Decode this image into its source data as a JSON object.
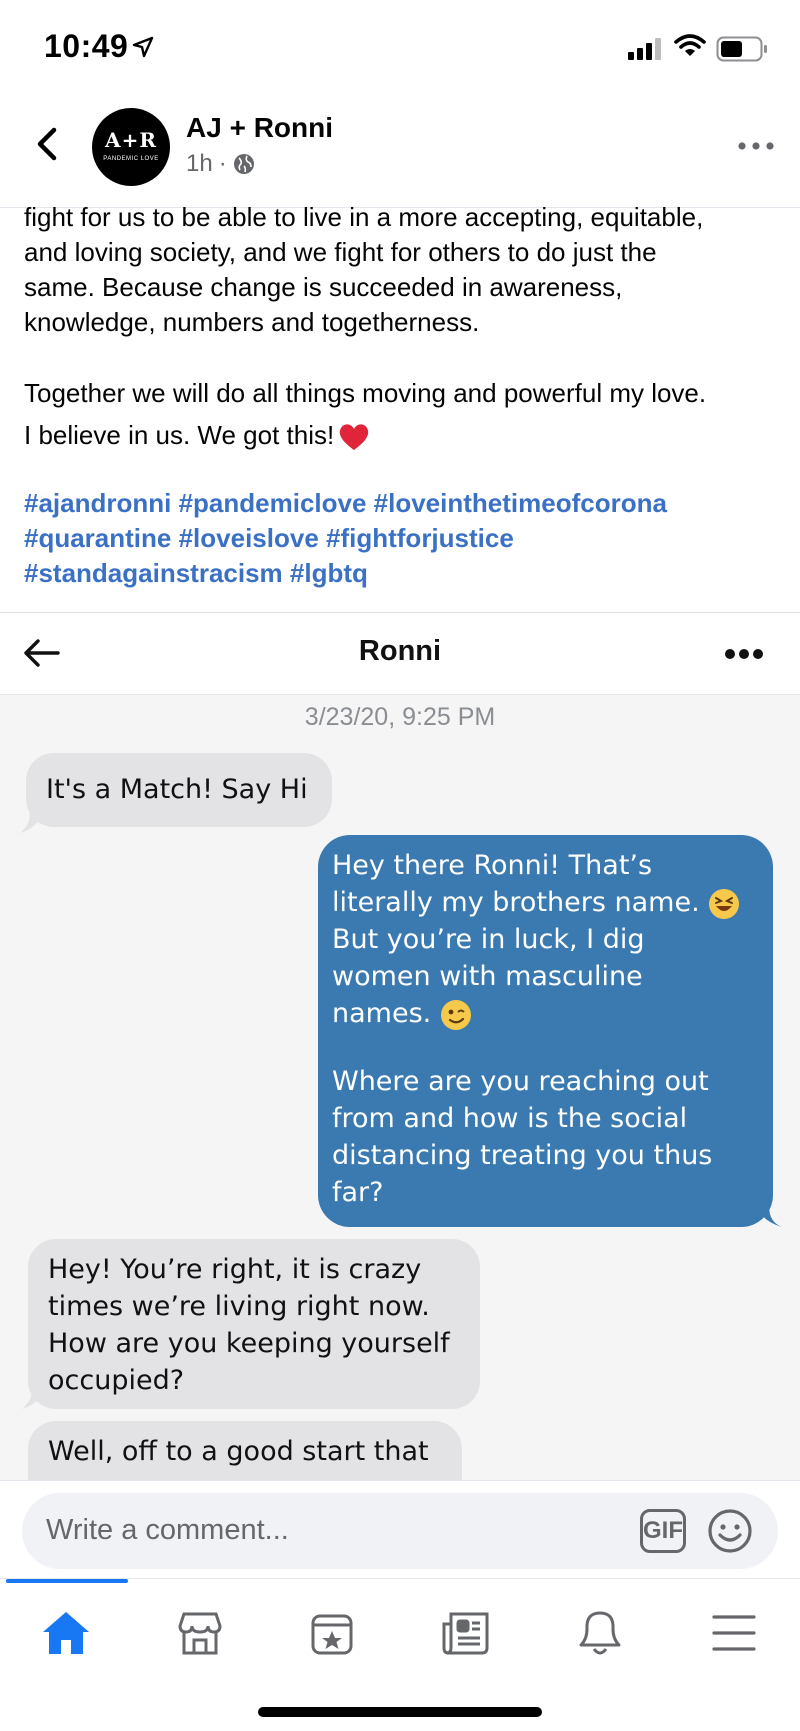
{
  "status_bar": {
    "time": "10:49"
  },
  "post": {
    "page_name": "AJ + Ronni",
    "time_ago": "1h",
    "avatar": {
      "mark": "A+R",
      "subtitle": "PANDEMIC LOVE"
    },
    "paragraph_1": [
      "fight for us to be able to live in a more accepting, equitable,",
      "and loving society, and we fight for others to do just the",
      "same. Because change is succeeded in awareness,",
      "knowledge, numbers and togetherness."
    ],
    "paragraph_2": [
      "Together we will do all things moving and powerful my love.",
      "I believe in us. We got this!"
    ],
    "hashtags": [
      "#ajandronni #pandemiclove #loveinthetimeofcorona",
      "#quarantine #loveislove #fightforjustice",
      "#standagainstracism #lgbtq"
    ]
  },
  "chat": {
    "title": "Ronni",
    "date": "3/23/20, 9:25 PM",
    "messages": [
      {
        "from": "them",
        "lines": [
          "It's a Match! Say Hi"
        ]
      },
      {
        "from": "me",
        "lines": [
          "Hey there Ronni! That’s",
          "literally my brothers name.",
          "But you’re in luck, I dig",
          "women with masculine",
          "names.",
          "",
          "Where are you reaching out",
          "from and how is the social",
          "distancing treating you thus",
          "far?"
        ]
      },
      {
        "from": "them",
        "lines": [
          "Hey! You’re right, it is crazy",
          "times we’re living right now.",
          "How are you keeping yourself",
          "occupied?"
        ]
      },
      {
        "from": "them",
        "lines": [
          "Well, off to a good start that"
        ]
      }
    ]
  },
  "comment_bar": {
    "placeholder": "Write a comment...",
    "gif_label": "GIF"
  },
  "nav": {
    "items": [
      "home-icon",
      "marketplace-icon",
      "events-icon",
      "news-icon",
      "notifications-icon",
      "menu-icon"
    ],
    "active": "home-icon",
    "active_color": "#1877f2"
  },
  "colors": {
    "hashtag": "#3b71c4",
    "outgoing_bubble": "#3a7ab0",
    "incoming_bubble": "#e3e3e6"
  }
}
